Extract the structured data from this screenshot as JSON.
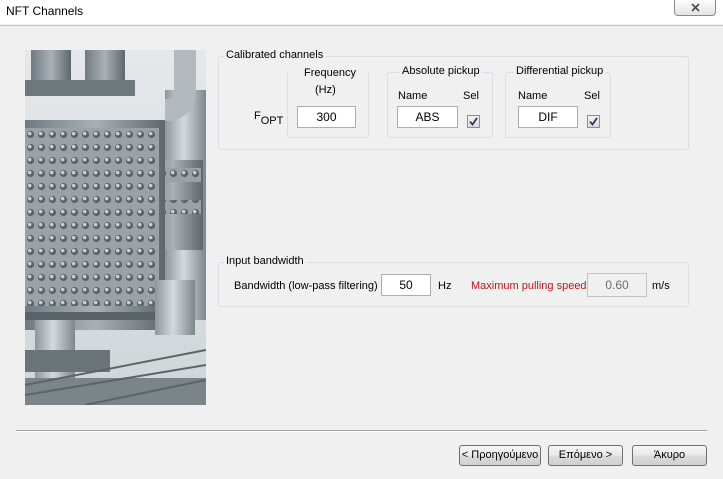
{
  "window": {
    "title": "NFT Channels"
  },
  "calibrated": {
    "legend": "Calibrated channels",
    "fopt_main": "F",
    "fopt_sub": "OPT",
    "frequency_label": "Frequency",
    "frequency_unit": "(Hz)",
    "frequency_value": "300",
    "absolute": {
      "legend": "Absolute pickup",
      "name_label": "Name",
      "sel_label": "Sel",
      "name_value": "ABS",
      "selected": true
    },
    "differential": {
      "legend": "Differential pickup",
      "name_label": "Name",
      "sel_label": "Sel",
      "name_value": "DIF",
      "selected": true
    }
  },
  "bandwidth": {
    "legend": "Input bandwidth",
    "label": "Bandwidth (low-pass filtering)",
    "value": "50",
    "unit": "Hz",
    "max_speed_label": "Maximum pulling speed",
    "max_speed_value": "0.60",
    "max_speed_unit": "m/s",
    "accent_color": "#c0141c"
  },
  "buttons": {
    "back": "< Προηγούμενο",
    "next": "Επόμενο >",
    "cancel": "Άκυρο"
  },
  "icons": {
    "close": "close-icon",
    "check": "check-icon",
    "photo": "heat-exchanger-photo"
  }
}
